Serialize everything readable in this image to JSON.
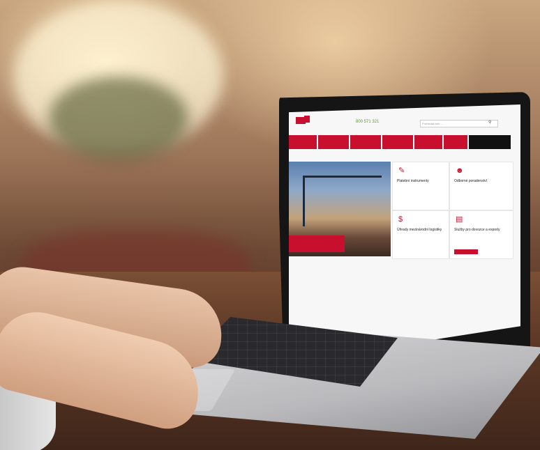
{
  "scene": {
    "description_colors": {
      "accent": "#c8102e",
      "phone_green": "#5aa02c",
      "dark_nav": "#111111"
    }
  },
  "website": {
    "phone": "800 571 321",
    "search_placeholder": "Prohledat web ...",
    "nav_items": [
      "",
      "",
      "",
      "",
      "",
      "",
      ""
    ],
    "breadcrumb": "",
    "hero_caption": "",
    "tiles": [
      {
        "title": "Platební instrumenty",
        "icon": "document-icon"
      },
      {
        "title": "Odborné poradenství",
        "icon": "person-icon"
      },
      {
        "title": "Úhrady mezinárodní logistiky",
        "icon": "dollar-icon"
      },
      {
        "title": "Služby pro dovozce a exporty",
        "icon": "chart-icon",
        "button": ""
      }
    ]
  }
}
